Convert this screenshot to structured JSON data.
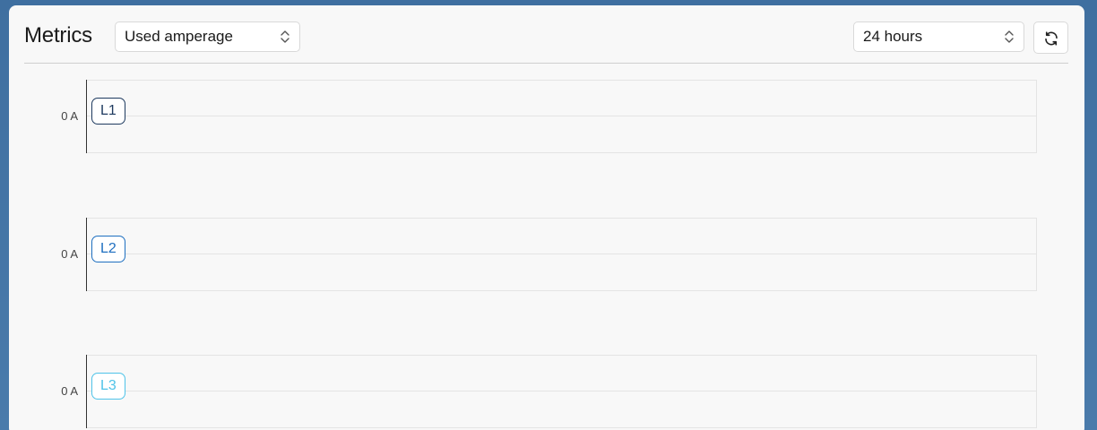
{
  "header": {
    "title": "Metrics",
    "metric_select": {
      "value": "Used amperage",
      "icon": "chevron-up-down-icon"
    },
    "range_select": {
      "value": "24 hours",
      "icon": "chevron-up-down-icon"
    },
    "refresh_button": {
      "icon": "refresh-icon"
    }
  },
  "charts": [
    {
      "badge": "L1",
      "y_label": "0 A",
      "color": "#1e3a5f"
    },
    {
      "badge": "L2",
      "y_label": "0 A",
      "color": "#1e6fc0"
    },
    {
      "badge": "L3",
      "y_label": "0 A",
      "color": "#4fc3e8"
    }
  ],
  "colors": {
    "background": "#4a7bab",
    "panel": "#f8f8f8",
    "border": "#d9d9d9"
  }
}
